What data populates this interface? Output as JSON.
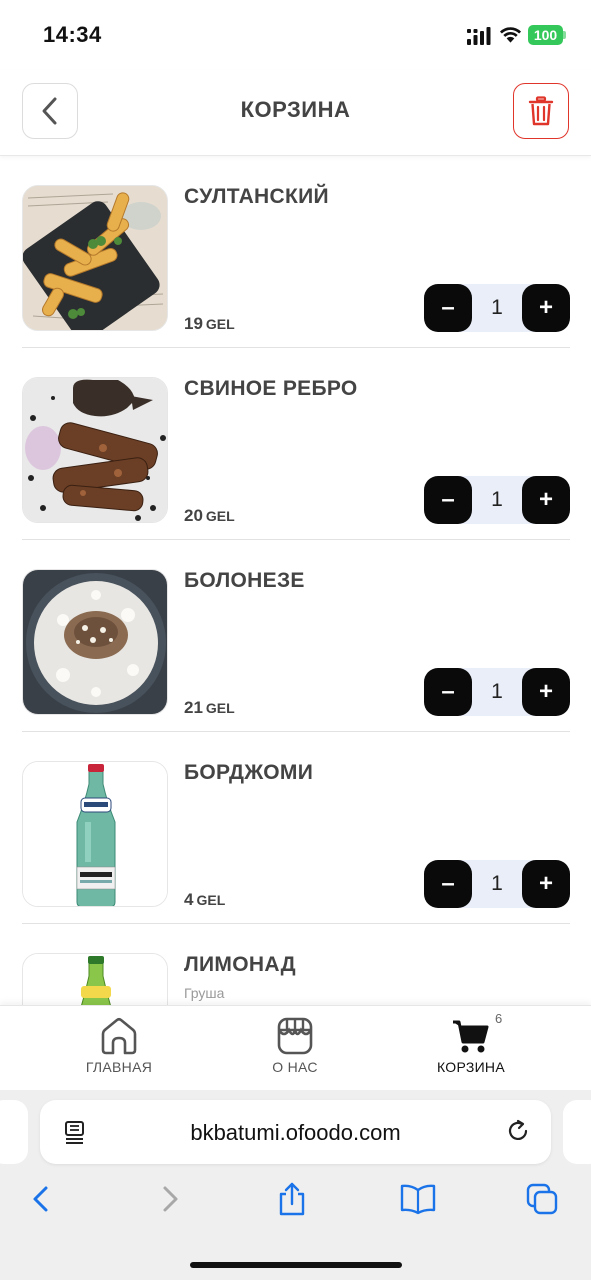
{
  "status_bar": {
    "time": "14:34",
    "battery": "100"
  },
  "header": {
    "title": "КОРЗИНА"
  },
  "cart": {
    "items": [
      {
        "name": "СУЛТАНСКИЙ",
        "subtitle": "",
        "price": "19",
        "currency": "GEL",
        "qty": "1",
        "minus": "–",
        "plus": "+"
      },
      {
        "name": "СВИНОЕ РЕБРО",
        "subtitle": "",
        "price": "20",
        "currency": "GEL",
        "qty": "1",
        "minus": "–",
        "plus": "+"
      },
      {
        "name": "БОЛОНЕЗЕ",
        "subtitle": "",
        "price": "21",
        "currency": "GEL",
        "qty": "1",
        "minus": "–",
        "plus": "+"
      },
      {
        "name": "БОРДЖОМИ",
        "subtitle": "",
        "price": "4",
        "currency": "GEL",
        "qty": "1",
        "minus": "–",
        "plus": "+"
      },
      {
        "name": "ЛИМОНАД",
        "subtitle": "Груша"
      }
    ]
  },
  "bottom_nav": {
    "home": "ГЛАВНАЯ",
    "about": "О НАС",
    "cart": "КОРЗИНА",
    "cart_count": "6"
  },
  "browser": {
    "url": "bkbatumi.ofoodo.com"
  },
  "colors": {
    "accent_red": "#e0352b",
    "button_black": "#0a0a0a",
    "qty_bg": "#e9eef8",
    "safari_blue": "#1a73e8"
  }
}
